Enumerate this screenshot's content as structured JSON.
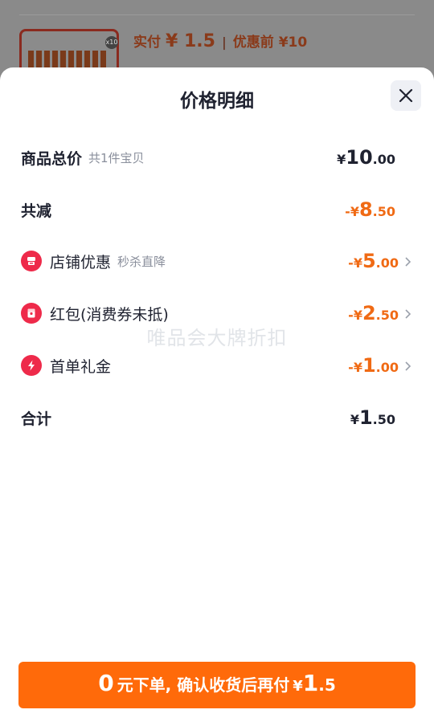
{
  "background": {
    "paid_label": "实付",
    "paid_value": "¥ 1.5",
    "separator": "|",
    "before_discount": "优惠前 ¥10",
    "qty_badge": "x10"
  },
  "sheet": {
    "title": "价格明细",
    "close_icon": "close-icon"
  },
  "rows": {
    "total": {
      "label": "商品总价",
      "sub": "共1件宝贝",
      "yen": "¥",
      "int": "10",
      "dec": ".00"
    },
    "reduced": {
      "label": "共减",
      "yen": "-¥",
      "int": "8",
      "dec": ".50"
    },
    "store": {
      "label": "店铺优惠",
      "sub": "秒杀直降",
      "yen": "-¥",
      "int": "5",
      "dec": ".00",
      "icon": "store-icon"
    },
    "redpacket": {
      "label": "红包(消费券未抵)",
      "yen": "-¥",
      "int": "2",
      "dec": ".50",
      "icon": "red-packet-icon"
    },
    "firstorder": {
      "label": "首单礼金",
      "yen": "-¥",
      "int": "1",
      "dec": ".00",
      "icon": "lightning-icon"
    },
    "sum": {
      "label": "合计",
      "yen": "¥",
      "int": "1",
      "dec": ".50"
    }
  },
  "watermark": "唯品会大牌折扣",
  "cta": {
    "zero": "0",
    "text": "元下单, 确认收货后再付",
    "yen": "¥",
    "pay_int": "1",
    "pay_dec": ".5"
  },
  "colors": {
    "accent": "#ff6a0a",
    "discount_text": "#f06a14",
    "icon_red": "#ee2a4a",
    "text_dark": "#1f2230",
    "text_muted": "#8a8f9c"
  }
}
